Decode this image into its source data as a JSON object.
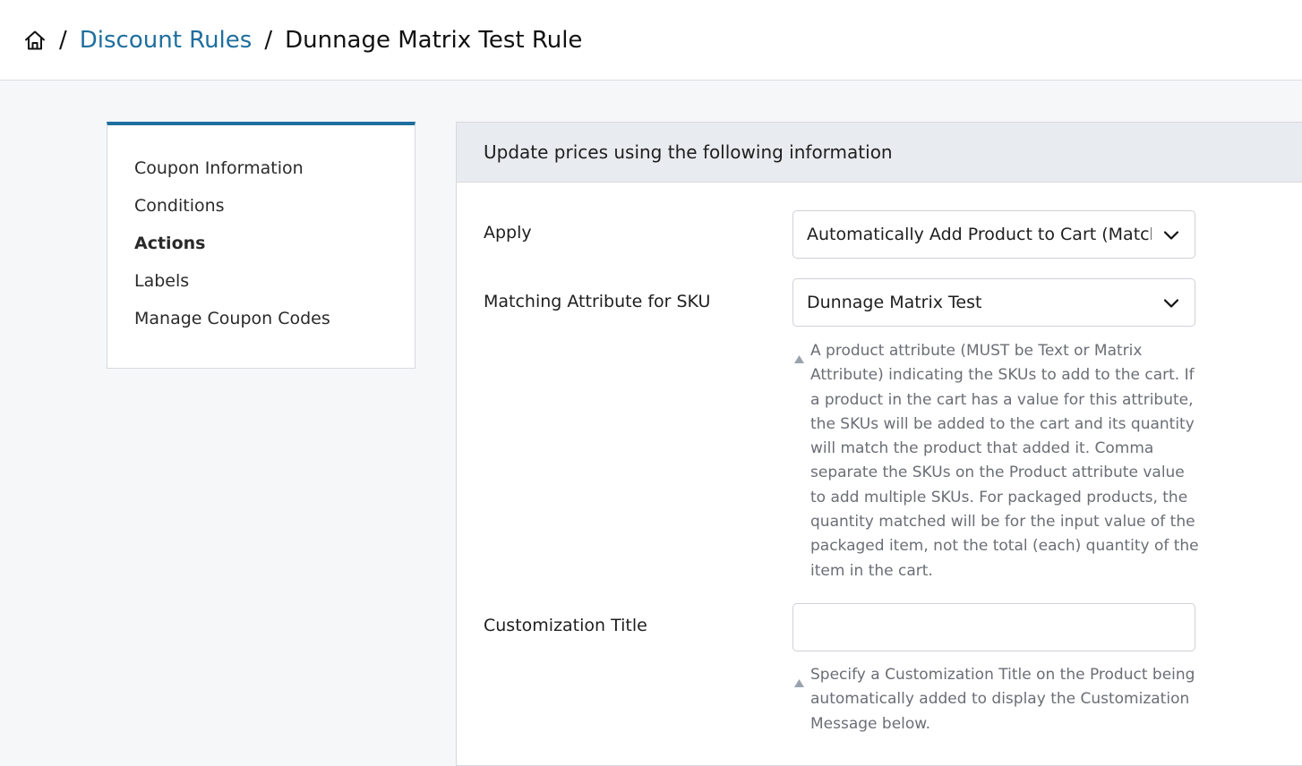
{
  "breadcrumb": {
    "home_icon": "home-icon",
    "separator": "/",
    "parent": "Discount Rules",
    "current": "Dunnage Matrix Test Rule"
  },
  "sidenav": {
    "accent_color": "#1f6f9e",
    "items": [
      {
        "label": "Coupon Information",
        "active": false
      },
      {
        "label": "Conditions",
        "active": false
      },
      {
        "label": "Actions",
        "active": true
      },
      {
        "label": "Labels",
        "active": false
      },
      {
        "label": "Manage Coupon Codes",
        "active": false
      }
    ]
  },
  "panel": {
    "header": "Update prices using the following information",
    "apply": {
      "label": "Apply",
      "value": "Automatically Add Product to Cart (Match"
    },
    "matching_attribute": {
      "label": "Matching Attribute for SKU",
      "value": "Dunnage Matrix Test",
      "help": "A product attribute (MUST be Text or Matrix Attribute) indicating the SKUs to add to the cart. If a product in the cart has a value for this attribute, the SKUs will be added to the cart and its quantity will match the product that added it. Comma separate the SKUs on the Product attribute value to add multiple SKUs. For packaged products, the quantity matched will be for the input value of the packaged item, not the total (each) quantity of the item in the cart."
    },
    "customization_title": {
      "label": "Customization Title",
      "value": "",
      "help": "Specify a Customization Title on the Product being automatically added to display the Customization Message below."
    }
  }
}
